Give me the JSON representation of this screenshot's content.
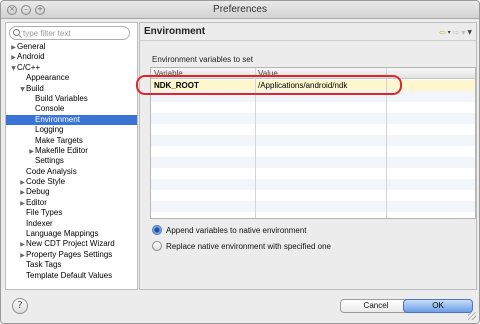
{
  "window": {
    "title": "Preferences",
    "close_glyph": "×",
    "minimize_glyph": "–",
    "zoom_glyph": "+"
  },
  "sidebar": {
    "filter_placeholder": "type filter text",
    "tree": [
      {
        "label": "General",
        "expander": "▶",
        "level": 0,
        "selected": false
      },
      {
        "label": "Android",
        "expander": "▶",
        "level": 0,
        "selected": false
      },
      {
        "label": "C/C++",
        "expander": "▼",
        "level": 0,
        "selected": false
      },
      {
        "label": "Appearance",
        "expander": "",
        "level": 1,
        "selected": false
      },
      {
        "label": "Build",
        "expander": "▼",
        "level": 1,
        "selected": false
      },
      {
        "label": "Build Variables",
        "expander": "",
        "level": 2,
        "selected": false
      },
      {
        "label": "Console",
        "expander": "",
        "level": 2,
        "selected": false
      },
      {
        "label": "Environment",
        "expander": "",
        "level": 2,
        "selected": true
      },
      {
        "label": "Logging",
        "expander": "",
        "level": 2,
        "selected": false
      },
      {
        "label": "Make Targets",
        "expander": "",
        "level": 2,
        "selected": false
      },
      {
        "label": "Makefile Editor",
        "expander": "▶",
        "level": 2,
        "selected": false
      },
      {
        "label": "Settings",
        "expander": "",
        "level": 2,
        "selected": false
      },
      {
        "label": "Code Analysis",
        "expander": "",
        "level": 1,
        "selected": false
      },
      {
        "label": "Code Style",
        "expander": "▶",
        "level": 1,
        "selected": false
      },
      {
        "label": "Debug",
        "expander": "▶",
        "level": 1,
        "selected": false
      },
      {
        "label": "Editor",
        "expander": "▶",
        "level": 1,
        "selected": false
      },
      {
        "label": "File Types",
        "expander": "",
        "level": 1,
        "selected": false
      },
      {
        "label": "Indexer",
        "expander": "",
        "level": 1,
        "selected": false
      },
      {
        "label": "Language Mappings",
        "expander": "",
        "level": 1,
        "selected": false
      },
      {
        "label": "New CDT Project Wizard",
        "expander": "▶",
        "level": 1,
        "selected": false
      },
      {
        "label": "Property Pages Settings",
        "expander": "▶",
        "level": 1,
        "selected": false
      },
      {
        "label": "Task Tags",
        "expander": "",
        "level": 1,
        "selected": false
      },
      {
        "label": "Template Default Values",
        "expander": "",
        "level": 1,
        "selected": false
      }
    ]
  },
  "main": {
    "title": "Environment",
    "nav": {
      "back": "⇦",
      "back_menu": "▾",
      "forward": "⇨",
      "forward_menu": "▾",
      "view_menu": "▼"
    },
    "section_label": "Environment variables to set",
    "table": {
      "columns": [
        "Variable",
        "Value"
      ],
      "rows": [
        {
          "variable": "NDK_ROOT",
          "value": "/Applications/android/ndk"
        }
      ],
      "empty_rows": 12
    },
    "options": [
      {
        "label": "Append variables to native environment",
        "selected": true
      },
      {
        "label": "Replace native environment with specified one",
        "selected": false
      }
    ]
  },
  "footer": {
    "help_glyph": "?",
    "cancel_label": "Cancel",
    "ok_label": "OK"
  },
  "colors": {
    "selection": "#3875d7",
    "highlight_row": "#fdf6cf",
    "annotation": "#e0262b",
    "ok_button": "#6b9fe5"
  },
  "icons": [
    "close-icon",
    "minimize-icon",
    "zoom-icon",
    "search-icon",
    "back-arrow-icon",
    "forward-arrow-icon",
    "view-menu-icon",
    "help-icon",
    "resize-grip-icon"
  ]
}
